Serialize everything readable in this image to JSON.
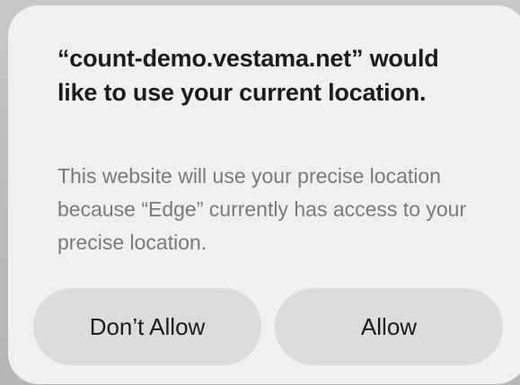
{
  "dialog": {
    "title": "“count-demo.vestama.net” would like to use your current location.",
    "message": "This website will use your precise location because “Edge” currently has access to your precise location.",
    "buttons": {
      "dont_allow_label": "Don’t Allow",
      "allow_label": "Allow"
    }
  },
  "colors": {
    "dialog_background": "#f0f0f0",
    "button_background": "#dcdcdc",
    "title_text": "#1c1c1e",
    "message_text": "#7a7a7a"
  }
}
